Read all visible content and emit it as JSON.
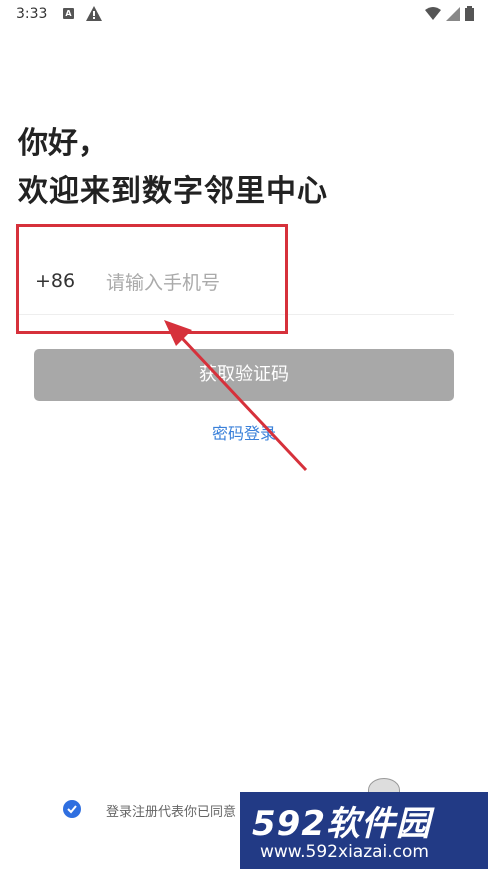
{
  "status_bar": {
    "time": "3:33",
    "icons": [
      "a-icon",
      "warning-icon",
      "wifi-icon",
      "signal-icon",
      "battery-icon"
    ]
  },
  "heading": {
    "greeting": "你好，",
    "welcome": "欢迎来到数字邻里中心"
  },
  "phone": {
    "country_code": "+86",
    "placeholder": "请输入手机号",
    "value": ""
  },
  "get_code_button": "获取验证码",
  "password_login_link": "密码登录",
  "agreement": {
    "checked": true,
    "text": "登录注册代表你已同意"
  },
  "watermark": {
    "brand": "592软件园",
    "url": "www.592xiazai.com"
  },
  "colors": {
    "accent": "#3a80d9",
    "button_disabled": "#a8a8a8",
    "highlight": "#d6313b",
    "watermark_bg": "#223a85"
  }
}
